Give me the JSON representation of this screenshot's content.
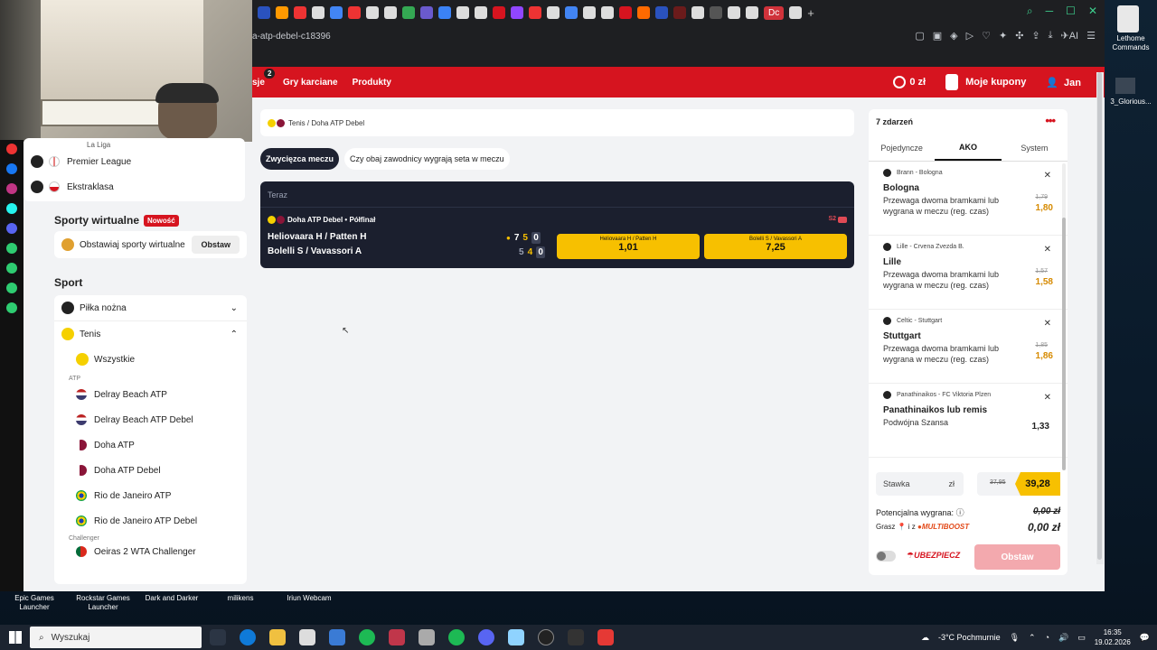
{
  "browser": {
    "url_fragment": "a-atp-debel-c18396"
  },
  "topnav": {
    "badge": "2",
    "partial_item": "sje",
    "items": [
      "Gry karciane",
      "Produkty"
    ],
    "balance": "0 zł",
    "coupons": "Moje kupony",
    "user": "Jan"
  },
  "sidebar": {
    "partial_top": "La Liga",
    "leagues": [
      {
        "label": "Premier League"
      },
      {
        "label": "Ekstraklasa"
      }
    ],
    "virtual_title": "Sporty wirtualne",
    "virtual_badge": "Nowość",
    "virtual_item": "Obstawiaj sporty wirtualne",
    "virtual_button": "Obstaw",
    "sport_title": "Sport",
    "sports": [
      {
        "label": "Piłka nożna"
      },
      {
        "label": "Tenis"
      }
    ],
    "tennis_all": "Wszystkie",
    "atp_header": "ATP",
    "tournaments": [
      {
        "label": "Delray Beach ATP"
      },
      {
        "label": "Delray Beach ATP Debel"
      },
      {
        "label": "Doha ATP"
      },
      {
        "label": "Doha ATP Debel"
      },
      {
        "label": "Rio de Janeiro ATP"
      },
      {
        "label": "Rio de Janeiro ATP Debel"
      }
    ],
    "challenger_header": "Challenger",
    "challenger_item": "Oeiras 2 WTA Challenger"
  },
  "main": {
    "breadcrumb": "Tenis / Doha ATP Debel",
    "tabs": [
      {
        "label": "Zwycięzca meczu"
      },
      {
        "label": "Czy obaj zawodnicy wygrają seta w meczu"
      }
    ],
    "match": {
      "status": "Teraz",
      "league": "Doha ATP Debel • Półfinał",
      "set_label": "S2",
      "team1": "Heliovaara H / Patten H",
      "team2": "Bolelli S / Vavassori A",
      "score1": [
        "7",
        "5",
        "0"
      ],
      "score2": [
        "5",
        "4",
        "0"
      ],
      "odds": [
        {
          "name": "Heliovaara H / Patten H",
          "value": "1,01"
        },
        {
          "name": "Bolelli S / Vavassori A",
          "value": "7,25"
        }
      ]
    }
  },
  "betslip": {
    "count": "7 zdarzeń",
    "tabs": [
      "Pojedyncze",
      "AKO",
      "System"
    ],
    "selections": [
      {
        "event": "Brann - Bologna",
        "pick": "Bologna",
        "market": "Przewaga dwoma bramkami lub wygrana w meczu (reg. czas)",
        "old": "1,79",
        "new": "1,80"
      },
      {
        "event": "Lille - Crvena Zvezda B.",
        "pick": "Lille",
        "market": "Przewaga dwoma bramkami lub wygrana w meczu (reg. czas)",
        "old": "1,57",
        "new": "1,58"
      },
      {
        "event": "Celtic - Stuttgart",
        "pick": "Stuttgart",
        "market": "Przewaga dwoma bramkami lub wygrana w meczu (reg. czas)",
        "old": "1,85",
        "new": "1,86"
      },
      {
        "event": "Panathinaikos - FC Viktoria Plzen",
        "pick": "Panathinaikos lub remis",
        "market": "Podwójna Szansa",
        "old": "",
        "new": "1,33"
      }
    ],
    "stake_label": "Stawka",
    "currency": "zł",
    "old_total": "37,95",
    "total": "39,28",
    "potential_label": "Potencjalna wygrana:",
    "potential_value": "0,00 zł",
    "grasz_label": "Grasz",
    "grasz_mid": "i z",
    "multiboost": "MULTIBOOST",
    "grasz_value": "0,00 zł",
    "ubezpiecz": "UBEZPIECZ",
    "submit": "Obstaw"
  },
  "desktop": {
    "icons": [
      {
        "label": "Epic Games Launcher"
      },
      {
        "label": "Rockstar Games Launcher"
      },
      {
        "label": "Dark and Darker"
      },
      {
        "label": "milikens"
      },
      {
        "label": "Iriun Webcam"
      }
    ],
    "right_apps": [
      "Lethome Commands",
      "3_Glorious..."
    ]
  },
  "taskbar": {
    "search": "Wyszukaj",
    "weather": "-3°C Pochmurnie",
    "time": "16:35",
    "date": "19.02.2026"
  },
  "colors": {
    "brand_red": "#d6141f",
    "odds_yellow": "#f7c000",
    "dark_card": "#1b1f2e"
  }
}
